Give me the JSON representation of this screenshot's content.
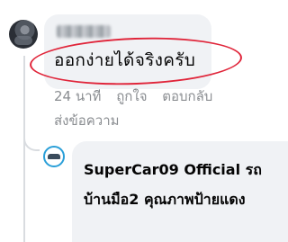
{
  "comment": {
    "text": "ออกง่ายได้จริงครับ",
    "time": "24 นาที",
    "like": "ถูกใจ",
    "reply": "ตอบกลับ",
    "send_message": "ส่งข้อความ"
  },
  "reply_comment": {
    "text": "SuperCar09 Official รถบ้านมือ2 คุณภาพป้ายแดง"
  },
  "colors": {
    "bubble": "#f0f2f5",
    "meta_text": "#8a8d91",
    "annotation_red": "#e0253a"
  }
}
